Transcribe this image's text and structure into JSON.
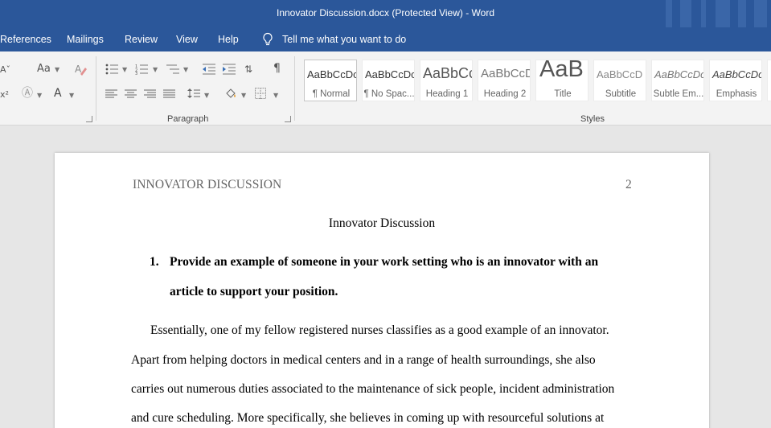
{
  "window": {
    "title": "Innovator Discussion.docx (Protected View)  -  Word"
  },
  "menu": {
    "items": [
      "References",
      "Mailings",
      "Review",
      "View",
      "Help"
    ],
    "tell_me": "Tell me what you want to do"
  },
  "ribbon": {
    "font_group": {
      "change_case": "Aa",
      "font_color": "A"
    },
    "paragraph_group": {
      "label": "Paragraph"
    },
    "styles_group": {
      "label": "Styles",
      "styles": [
        {
          "sample": "AaBbCcDc",
          "name": "¶ Normal"
        },
        {
          "sample": "AaBbCcDc",
          "name": "¶ No Spac..."
        },
        {
          "sample": "AaBbCc",
          "name": "Heading 1"
        },
        {
          "sample": "AaBbCcD",
          "name": "Heading 2"
        },
        {
          "sample": "AaB",
          "name": "Title"
        },
        {
          "sample": "AaBbCcD",
          "name": "Subtitle"
        },
        {
          "sample": "AaBbCcDc",
          "name": "Subtle Em..."
        },
        {
          "sample": "AaBbCcDc",
          "name": "Emphasis"
        }
      ]
    }
  },
  "document": {
    "header_left": "INNOVATOR DISCUSSION",
    "page_number": "2",
    "title": "Innovator Discussion",
    "question_number": "1.",
    "question_lines": [
      "Provide an example of someone in your work setting who is an innovator with an",
      "article to support your position."
    ],
    "body_lines": [
      "Essentially, one of my fellow registered nurses classifies as a good example of an innovator.",
      "Apart from helping doctors in medical centers and in a range of health surroundings, she also",
      "carries out numerous duties associated to the maintenance of sick people, incident administration",
      "and cure scheduling. More specifically, she believes in coming up with resourceful solutions at"
    ]
  }
}
